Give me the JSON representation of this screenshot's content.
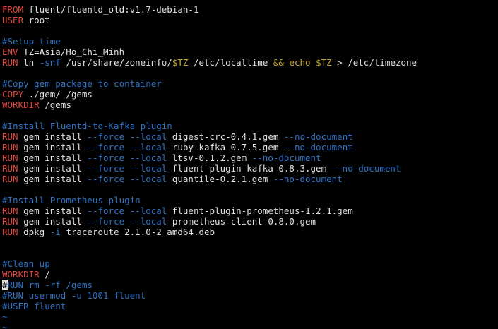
{
  "editor": {
    "lines": [
      [
        {
          "t": "FROM",
          "k": "kw"
        },
        {
          "t": " fluent/fluentd_old:v1.7-debian-1",
          "k": "txt"
        }
      ],
      [
        {
          "t": "USER",
          "k": "kw"
        },
        {
          "t": " root",
          "k": "txt"
        }
      ],
      [],
      [
        {
          "t": "#Setup time",
          "k": "cm"
        }
      ],
      [
        {
          "t": "ENV",
          "k": "kw"
        },
        {
          "t": " TZ=Asia/Ho_Chi_Minh",
          "k": "txt"
        }
      ],
      [
        {
          "t": "RUN",
          "k": "kw"
        },
        {
          "t": " ln ",
          "k": "txt"
        },
        {
          "t": "-snf",
          "k": "fl"
        },
        {
          "t": " /usr/share/zoneinfo/",
          "k": "txt"
        },
        {
          "t": "$TZ",
          "k": "vr"
        },
        {
          "t": " /etc/localtime ",
          "k": "txt"
        },
        {
          "t": "&&",
          "k": "op"
        },
        {
          "t": " ",
          "k": "txt"
        },
        {
          "t": "echo",
          "k": "ec"
        },
        {
          "t": " ",
          "k": "txt"
        },
        {
          "t": "$TZ",
          "k": "vr"
        },
        {
          "t": " > /etc/timezone",
          "k": "txt"
        }
      ],
      [],
      [
        {
          "t": "#Copy gem package to container",
          "k": "cm"
        }
      ],
      [
        {
          "t": "COPY",
          "k": "kw"
        },
        {
          "t": " ./gem/ /gems",
          "k": "txt"
        }
      ],
      [
        {
          "t": "WORKDIR",
          "k": "kw"
        },
        {
          "t": " /gems",
          "k": "txt"
        }
      ],
      [],
      [
        {
          "t": "#Install Fluentd-to-Kafka plugin",
          "k": "cm"
        }
      ],
      [
        {
          "t": "RUN",
          "k": "kw"
        },
        {
          "t": " gem install ",
          "k": "txt"
        },
        {
          "t": "--force",
          "k": "fl"
        },
        {
          "t": " ",
          "k": "txt"
        },
        {
          "t": "--local",
          "k": "fl"
        },
        {
          "t": " digest-crc-0.4.1.gem ",
          "k": "txt"
        },
        {
          "t": "--no-document",
          "k": "fl"
        }
      ],
      [
        {
          "t": "RUN",
          "k": "kw"
        },
        {
          "t": " gem install ",
          "k": "txt"
        },
        {
          "t": "--force",
          "k": "fl"
        },
        {
          "t": " ",
          "k": "txt"
        },
        {
          "t": "--local",
          "k": "fl"
        },
        {
          "t": " ruby-kafka-0.7.5.gem ",
          "k": "txt"
        },
        {
          "t": "--no-document",
          "k": "fl"
        }
      ],
      [
        {
          "t": "RUN",
          "k": "kw"
        },
        {
          "t": " gem install ",
          "k": "txt"
        },
        {
          "t": "--force",
          "k": "fl"
        },
        {
          "t": " ",
          "k": "txt"
        },
        {
          "t": "--local",
          "k": "fl"
        },
        {
          "t": " ltsv-0.1.2.gem ",
          "k": "txt"
        },
        {
          "t": "--no-document",
          "k": "fl"
        }
      ],
      [
        {
          "t": "RUN",
          "k": "kw"
        },
        {
          "t": " gem install ",
          "k": "txt"
        },
        {
          "t": "--force",
          "k": "fl"
        },
        {
          "t": " ",
          "k": "txt"
        },
        {
          "t": "--local",
          "k": "fl"
        },
        {
          "t": " fluent-plugin-kafka-0.8.3.gem ",
          "k": "txt"
        },
        {
          "t": "--no-document",
          "k": "fl"
        }
      ],
      [
        {
          "t": "RUN",
          "k": "kw"
        },
        {
          "t": " gem install ",
          "k": "txt"
        },
        {
          "t": "--force",
          "k": "fl"
        },
        {
          "t": " ",
          "k": "txt"
        },
        {
          "t": "--local",
          "k": "fl"
        },
        {
          "t": " quantile-0.2.1.gem ",
          "k": "txt"
        },
        {
          "t": "--no-document",
          "k": "fl"
        }
      ],
      [],
      [
        {
          "t": "#Install Prometheus plugin",
          "k": "cm"
        }
      ],
      [
        {
          "t": "RUN",
          "k": "kw"
        },
        {
          "t": " gem install ",
          "k": "txt"
        },
        {
          "t": "--force",
          "k": "fl"
        },
        {
          "t": " ",
          "k": "txt"
        },
        {
          "t": "--local",
          "k": "fl"
        },
        {
          "t": " fluent-plugin-prometheus-1.2.1.gem",
          "k": "txt"
        }
      ],
      [
        {
          "t": "RUN",
          "k": "kw"
        },
        {
          "t": " gem install ",
          "k": "txt"
        },
        {
          "t": "--force",
          "k": "fl"
        },
        {
          "t": " ",
          "k": "txt"
        },
        {
          "t": "--local",
          "k": "fl"
        },
        {
          "t": " prometheus-client-0.8.0.gem",
          "k": "txt"
        }
      ],
      [
        {
          "t": "RUN",
          "k": "kw"
        },
        {
          "t": " dpkg ",
          "k": "txt"
        },
        {
          "t": "-i",
          "k": "fl"
        },
        {
          "t": " traceroute_2.1.0-2_amd64.deb",
          "k": "txt"
        }
      ],
      [],
      [],
      [
        {
          "t": "#Clean up",
          "k": "cm"
        }
      ],
      [
        {
          "t": "WORKDIR",
          "k": "kw"
        },
        {
          "t": " /",
          "k": "txt"
        }
      ],
      [
        {
          "t": "#",
          "k": "cursor"
        },
        {
          "t": "RUN rm -rf /gems",
          "k": "cm"
        }
      ],
      [
        {
          "t": "#RUN usermod -u 1001 fluent",
          "k": "cm"
        }
      ],
      [
        {
          "t": "#USER fluent",
          "k": "cm"
        }
      ],
      [
        {
          "t": "~",
          "k": "tl"
        }
      ],
      [
        {
          "t": "~",
          "k": "tl"
        }
      ]
    ]
  }
}
